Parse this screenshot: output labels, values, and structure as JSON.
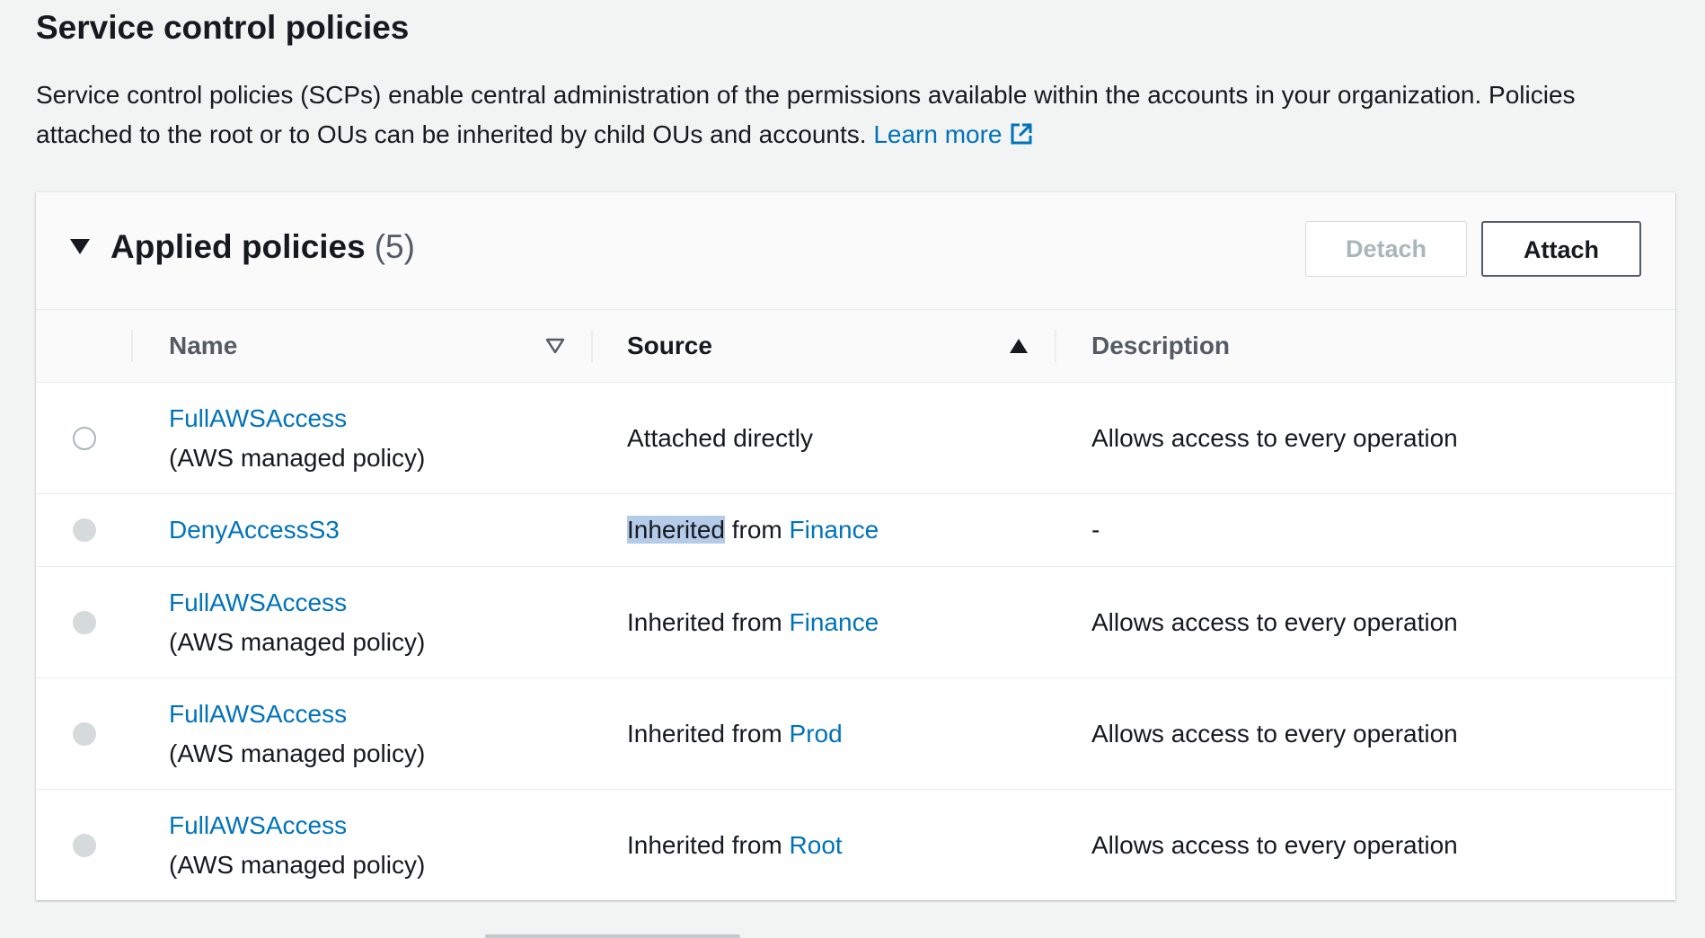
{
  "page": {
    "title": "Service control policies",
    "description": "Service control policies (SCPs) enable central administration of the permissions available within the accounts in your organization. Policies attached to the root or to OUs can be inherited by child OUs and accounts.",
    "learn_more": "Learn more",
    "learn_more_icon": "external-link-icon"
  },
  "panel": {
    "title": "Applied policies",
    "count": "(5)",
    "detach_label": "Detach",
    "attach_label": "Attach"
  },
  "table": {
    "columns": {
      "name": "Name",
      "source": "Source",
      "description": "Description"
    },
    "sort": {
      "name": "unsorted",
      "source": "ascending"
    },
    "rows": [
      {
        "name": "FullAWSAccess",
        "subtitle": "(AWS managed policy)",
        "source_prefix": "Attached directly",
        "source_link": "",
        "description": "Allows access to every operation",
        "selectable": true
      },
      {
        "name": "DenyAccessS3",
        "subtitle": "",
        "source_highlight": "Inherited",
        "source_prefix": " from ",
        "source_link": "Finance",
        "description": "-",
        "selectable": false
      },
      {
        "name": "FullAWSAccess",
        "subtitle": "(AWS managed policy)",
        "source_prefix": "Inherited from ",
        "source_link": "Finance",
        "description": "Allows access to every operation",
        "selectable": false
      },
      {
        "name": "FullAWSAccess",
        "subtitle": "(AWS managed policy)",
        "source_prefix": "Inherited from ",
        "source_link": "Prod",
        "description": "Allows access to every operation",
        "selectable": false
      },
      {
        "name": "FullAWSAccess",
        "subtitle": "(AWS managed policy)",
        "source_prefix": "Inherited from ",
        "source_link": "Root",
        "description": "Allows access to every operation",
        "selectable": false
      }
    ]
  },
  "colors": {
    "link": "#0073bb",
    "text": "#16191f",
    "muted": "#545b64",
    "selection_highlight": "#b4cbe9"
  }
}
